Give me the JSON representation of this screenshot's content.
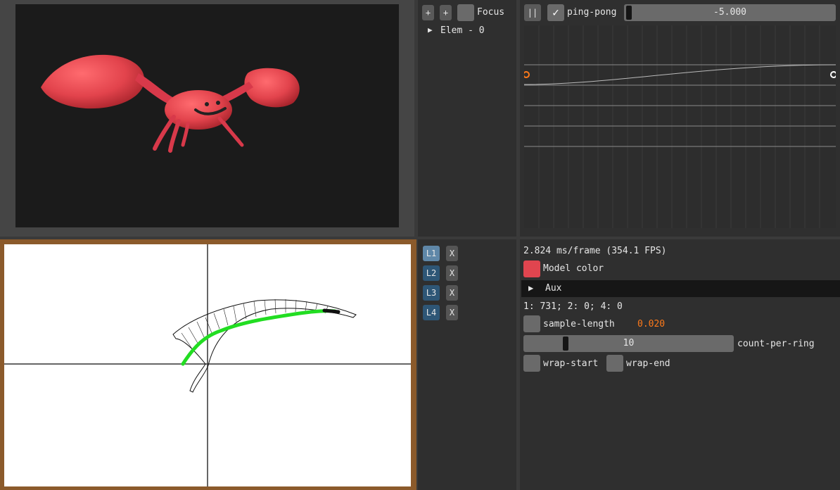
{
  "tree": {
    "add_btn_1": "+",
    "add_btn_2": "+",
    "focus_label": "Focus",
    "elem_arrow": "▶",
    "elem_label": "Elem - 0"
  },
  "timeline": {
    "pause_label": "||",
    "checkbox_mark": "✓",
    "pingpong_label": "ping-pong",
    "slider_value": "-5.000"
  },
  "layers": [
    {
      "label": "L1",
      "close": "X",
      "active": true
    },
    {
      "label": "L2",
      "close": "X",
      "active": false
    },
    {
      "label": "L3",
      "close": "X",
      "active": false
    },
    {
      "label": "L4",
      "close": "X",
      "active": false
    }
  ],
  "props": {
    "frame_stats": "2.824 ms/frame (354.1 FPS)",
    "model_color_label": "Model color",
    "model_color": "#e0454f",
    "aux_label": "Aux",
    "counts": "1: 731; 2: 0; 4: 0",
    "sample_length_label": "sample-length",
    "sample_length_value": "0.020",
    "count_per_ring_value": "10",
    "count_per_ring_label": "count-per-ring",
    "wrap_start_label": "wrap-start",
    "wrap_end_label": "wrap-end"
  },
  "colors": {
    "accent_orange": "#ff7a1a",
    "path_green": "#22dd22",
    "layer_active": "#5f87a8",
    "layer_inactive": "#2e5676"
  }
}
